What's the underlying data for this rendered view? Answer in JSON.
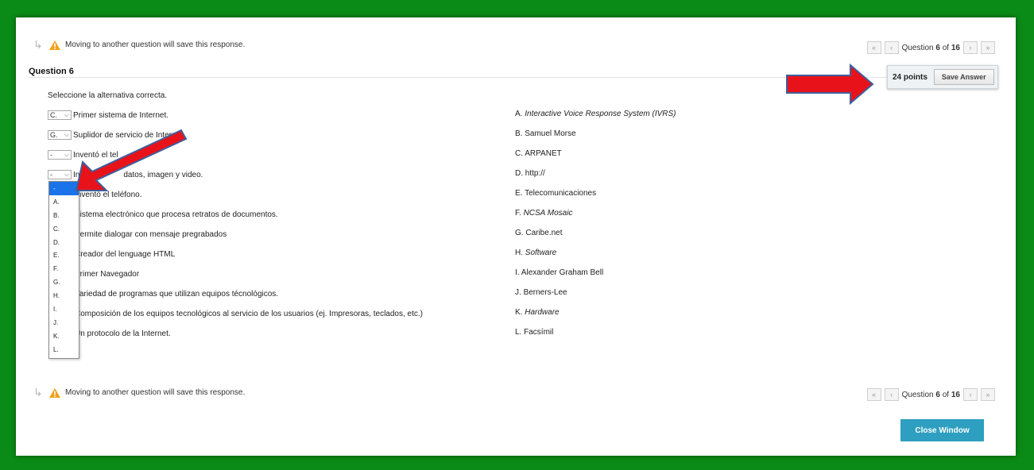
{
  "notice_text": "Moving to another question will save this response.",
  "nav": {
    "question_word": "Question",
    "current": "6",
    "of_word": "of",
    "total": "16",
    "first_icon": "«",
    "prev_icon": "‹",
    "next_icon": "›",
    "last_icon": "»"
  },
  "question": {
    "title": "Question 6",
    "points": "24 points",
    "save_label": "Save Answer",
    "instruction": "Seleccione la alternativa correcta."
  },
  "prompts": [
    {
      "selected": "C.",
      "text": "Primer sistema de Internet."
    },
    {
      "selected": "G.",
      "text": "Suplidor de servicio de Internet."
    },
    {
      "selected": "-",
      "text": "Inventó el tel"
    },
    {
      "selected": "-",
      "text": "Inc",
      "text_after": "datos, imagen y video."
    },
    {
      "text": "Inventó el teléfono."
    },
    {
      "text": "Sistema electrónico que procesa retratos de documentos."
    },
    {
      "text": "Permite dialogar con mensaje pregrabados"
    },
    {
      "text": "Creador del lenguage HTML"
    },
    {
      "text": "Primer Navegador"
    },
    {
      "text": "Variedad de programas que utilizan equipos técnológicos."
    },
    {
      "text": "Composición de los equipos tecnológicos al servicio de los usuarios (ej.  Impresoras, teclados, etc.)"
    },
    {
      "text": "Un protocolo de la Internet."
    }
  ],
  "answers": [
    {
      "letter": "A.",
      "text": "Interactive Voice Response System (IVRS)",
      "italic": true
    },
    {
      "letter": "B.",
      "text": "Samuel Morse"
    },
    {
      "letter": "C.",
      "text": "ARPANET"
    },
    {
      "letter": "D.",
      "text": "http://"
    },
    {
      "letter": "E.",
      "text": "Telecomunicaciones"
    },
    {
      "letter": "F.",
      "text": "NCSA Mosaic",
      "italic": true
    },
    {
      "letter": "G.",
      "text": "Caribe.net"
    },
    {
      "letter": "H.",
      "text": "Software",
      "italic": true
    },
    {
      "letter": "I.",
      "text": "Alexander Graham Bell"
    },
    {
      "letter": "J.",
      "text": "Berners-Lee"
    },
    {
      "letter": "K.",
      "text": "Hardware",
      "italic": true
    },
    {
      "letter": "L.",
      "text": "Facsímil"
    }
  ],
  "dropdown_options": [
    "-",
    "A.",
    "B.",
    "C.",
    "D.",
    "E.",
    "F.",
    "G.",
    "H.",
    "I.",
    "J.",
    "K.",
    "L."
  ],
  "close_window_label": "Close Window",
  "colors": {
    "background": "#0a8a16",
    "arrow_red": "#e8131a",
    "arrow_outline": "#3f5e9c",
    "close_button": "#2e9fc0",
    "dropdown_highlight": "#1a73e8"
  },
  "icons": {
    "warning": "warning-triangle-icon",
    "bend_arrow": "return-arrow-icon",
    "select_chevron": "chevron-down-icon"
  }
}
